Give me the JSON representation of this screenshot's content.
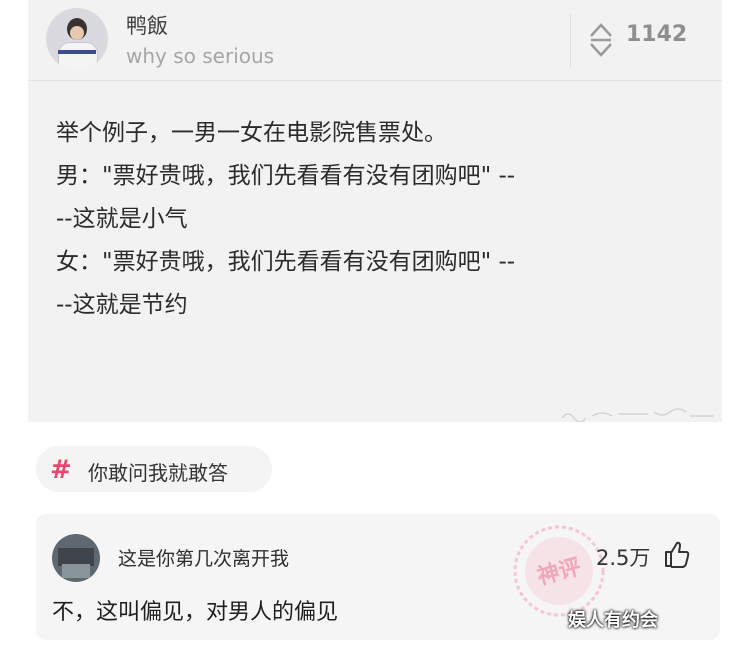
{
  "post": {
    "username": "鸭飯",
    "bio": "why so serious",
    "vote_count": "1142",
    "lines": [
      "举个例子，一男一女在电影院售票处。",
      "男：\"票好贵哦，我们先看看有没有团购吧\" --",
      "--这就是小气",
      "女：\"票好贵哦，我们先看看有没有团购吧\" --",
      "--这就是节约"
    ]
  },
  "topic": {
    "icon": "hashtag-icon",
    "label": "你敢问我就敢答"
  },
  "comment": {
    "author": "这是你第几次离开我",
    "likes": "2.5万",
    "text": "不，这叫偏见，对男人的偏见",
    "stamp_text": "神评"
  },
  "watermark": "娱人有约会",
  "colors": {
    "accent": "#e84870",
    "card_bg": "#f2f2f2"
  }
}
